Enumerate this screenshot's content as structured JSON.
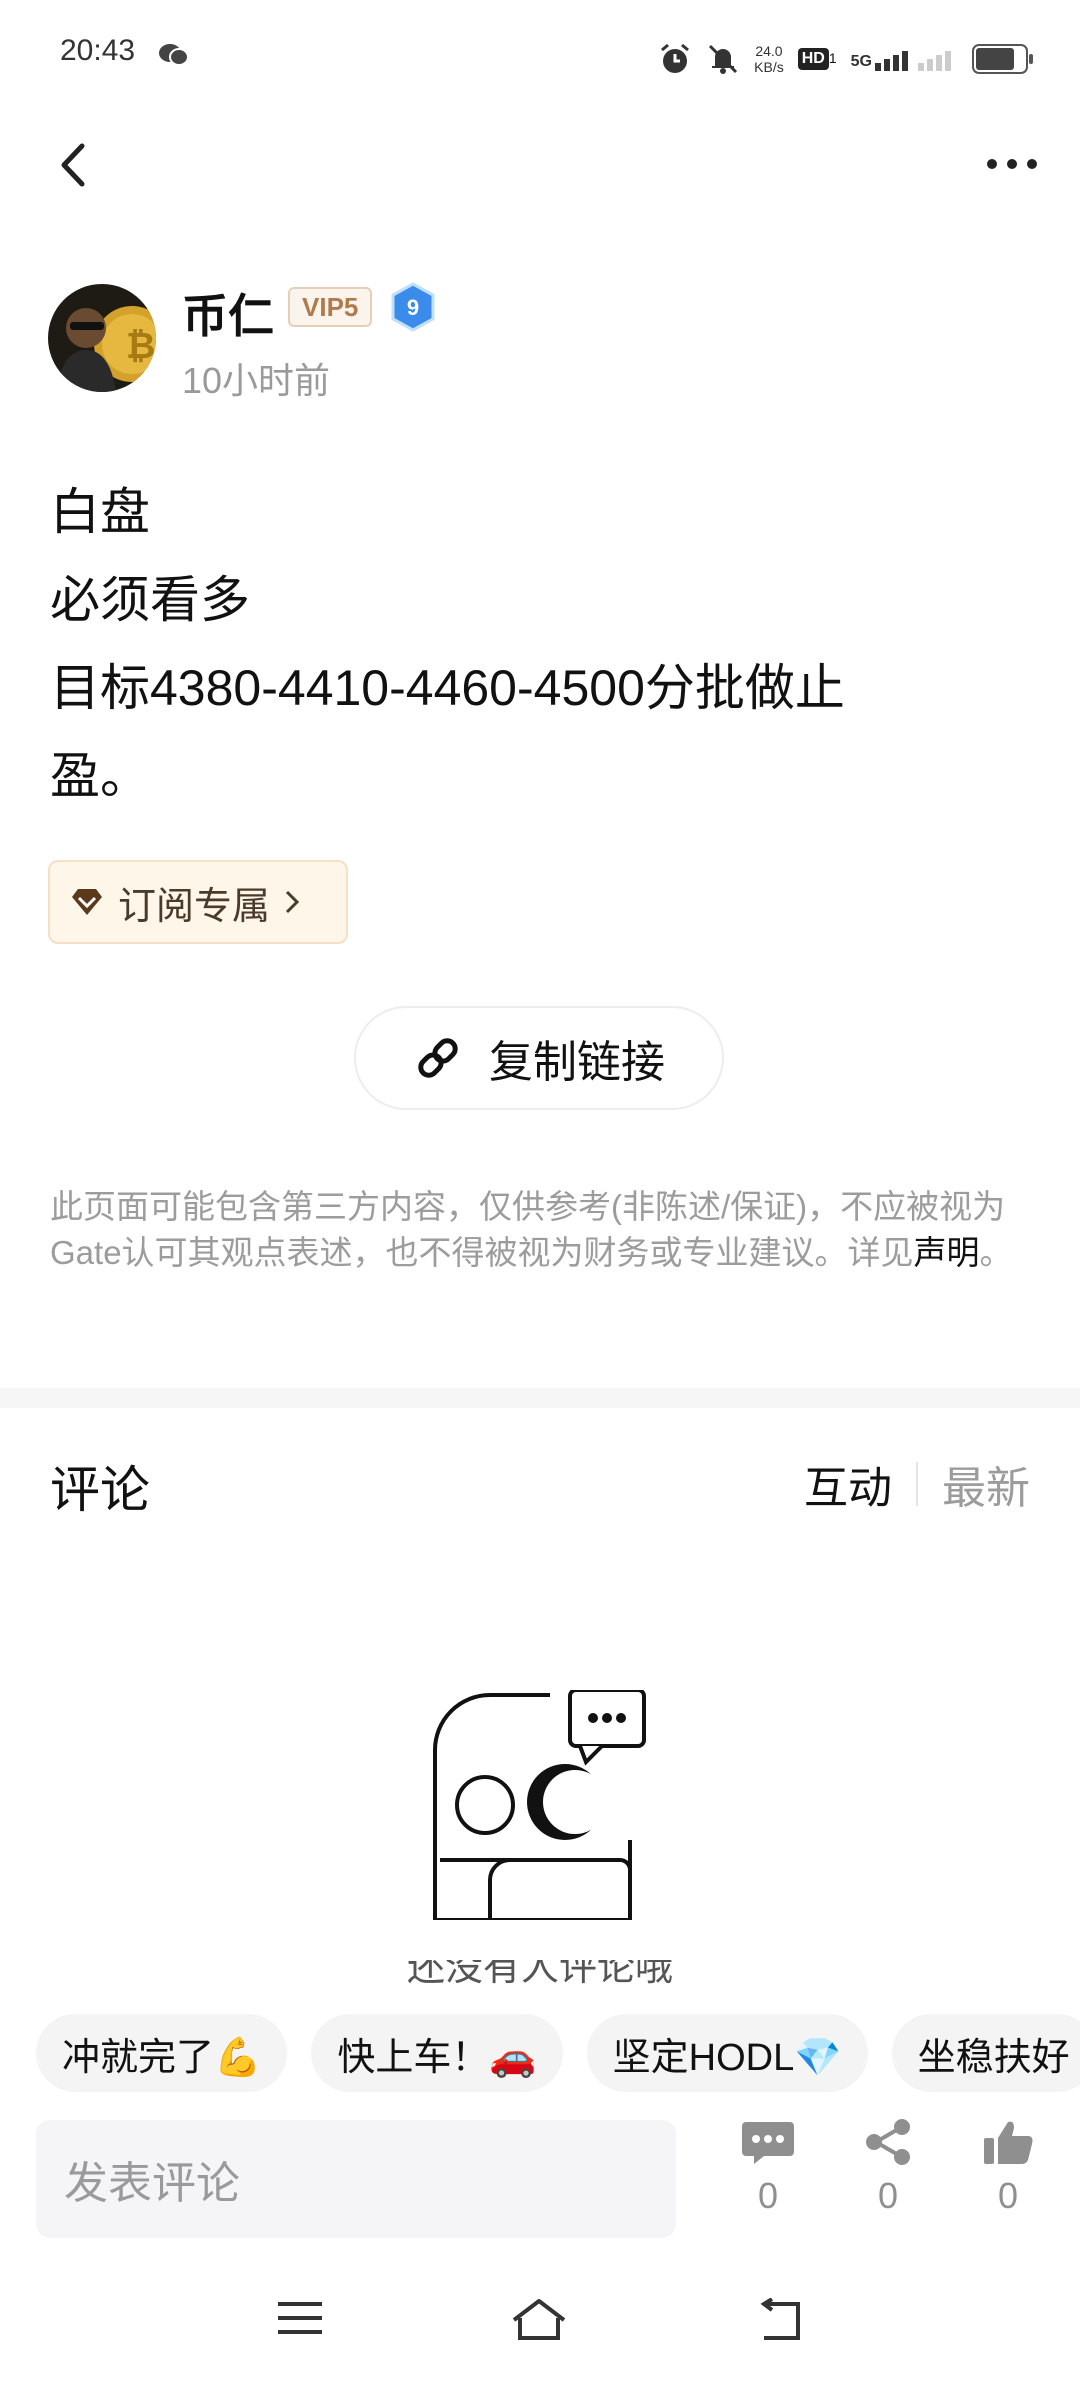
{
  "status_bar": {
    "time": "20:43",
    "speed_value": "24.0",
    "speed_unit": "KB/s",
    "hd": "HD",
    "hd_sub": "1",
    "network": "5G",
    "icons": [
      "wechat-icon",
      "alarm-icon",
      "mute-icon",
      "signal-icon",
      "battery-icon"
    ]
  },
  "header": {
    "back_icon": "back-arrow-icon",
    "more_icon": "more-dots-icon"
  },
  "author": {
    "name": "币仁",
    "vip_badge": "VIP5",
    "level": "9",
    "time": "10小时前"
  },
  "post": {
    "lines": [
      "白盘",
      "必须看多",
      "目标4380-4410-4460-4500分批做止",
      "盈。"
    ]
  },
  "subscribe_button": {
    "label": "订阅专属"
  },
  "copy_link_button": {
    "label": "复制链接"
  },
  "disclaimer": {
    "text": "此页面可能包含第三方内容，仅供参考(非陈述/保证)，不应被视为Gate认可其观点表述，也不得被视为财务或专业建议。详见",
    "link": "声明",
    "end": "。"
  },
  "comments": {
    "title": "评论",
    "sort_active": "互动",
    "sort_inactive": "最新",
    "empty_text": "还没有人评论哦"
  },
  "quick_replies": [
    "冲就完了💪",
    "快上车！🚗",
    "坚定HODL💎",
    "坐稳扶好"
  ],
  "bottom_bar": {
    "input_placeholder": "发表评论",
    "comment_count": "0",
    "share_count": "0",
    "like_count": "0"
  },
  "colors": {
    "accent_gold": "#b07a4a",
    "level_badge": "#3b8bea",
    "muted": "#9c9c9c"
  }
}
